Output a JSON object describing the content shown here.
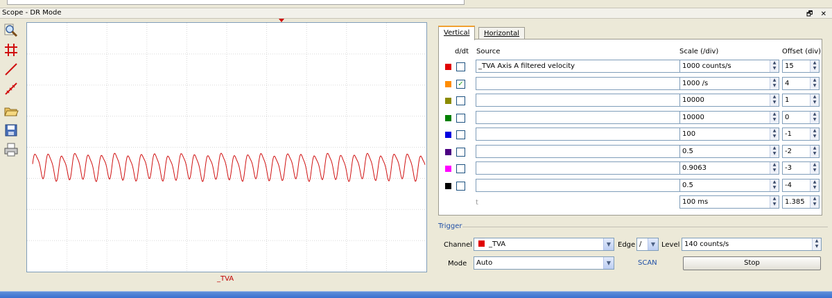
{
  "window": {
    "title": "Scope - DR Mode",
    "controls": "🗗 ✕"
  },
  "toolbar": {
    "tools": [
      {
        "name": "zoom-icon"
      },
      {
        "name": "grid-icon"
      },
      {
        "name": "cursor-line-icon"
      },
      {
        "name": "measure-icon"
      },
      {
        "name": "open-folder-icon"
      },
      {
        "name": "save-icon"
      },
      {
        "name": "print-icon"
      }
    ]
  },
  "scope": {
    "trace_label": "_TVA",
    "trace_color": "#d01010",
    "trace": {
      "cycles": 29.5,
      "center_div": 4.6,
      "amplitude_div": 0.45
    }
  },
  "tabs": {
    "vertical": "Vertical",
    "horizontal": "Horizontal"
  },
  "headers": {
    "ddt": "d/dt",
    "source": "Source",
    "scale": "Scale (/div)",
    "offset": "Offset (div)"
  },
  "channels": [
    {
      "color": "#e00000",
      "checked": false,
      "source": "_TVA Axis A filtered velocity",
      "scale": "1000 counts/s",
      "offset": "15"
    },
    {
      "color": "#ff8c00",
      "checked": true,
      "source": "",
      "scale": "1000 /s",
      "offset": "4"
    },
    {
      "color": "#8b8b00",
      "checked": false,
      "source": "",
      "scale": "10000",
      "offset": "1"
    },
    {
      "color": "#008000",
      "checked": false,
      "source": "",
      "scale": "10000",
      "offset": "0"
    },
    {
      "color": "#0000e0",
      "checked": false,
      "source": "",
      "scale": "100",
      "offset": "-1"
    },
    {
      "color": "#4b0082",
      "checked": false,
      "source": "",
      "scale": "0.5",
      "offset": "-2"
    },
    {
      "color": "#ff00ff",
      "checked": false,
      "source": "",
      "scale": "0.9063",
      "offset": "-3"
    },
    {
      "color": "#000000",
      "checked": false,
      "source": "",
      "scale": "0.5",
      "offset": "-4"
    }
  ],
  "time": {
    "label": "t",
    "scale": "100 ms",
    "offset": "1.385"
  },
  "trigger": {
    "title": "Trigger",
    "channel_label": "Channel",
    "channel_value": "_TVA",
    "channel_color": "#e00000",
    "edge_label": "Edge",
    "edge_value": "/",
    "level_label": "Level",
    "level_value": "140 counts/s",
    "mode_label": "Mode",
    "mode_value": "Auto",
    "status": "SCAN",
    "stop_label": "Stop"
  },
  "glyphs": {
    "check": "✓",
    "dropdown": "▼",
    "spin": "▲▼"
  }
}
